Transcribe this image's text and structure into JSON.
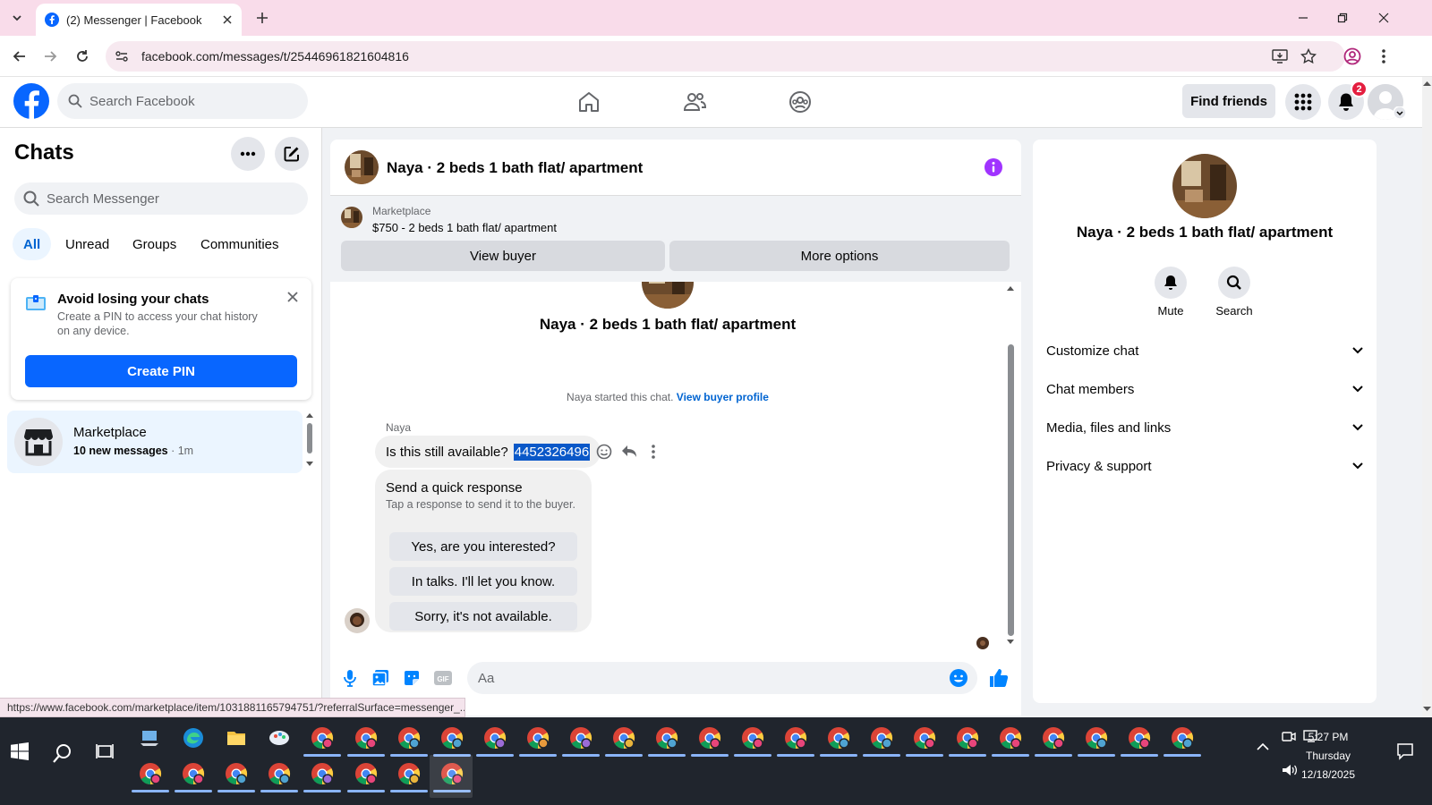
{
  "browser": {
    "tab_title": "(2) Messenger | Facebook",
    "url": "facebook.com/messages/t/25446961821604816",
    "status_url": "https://www.facebook.com/marketplace/item/1031881165794751/?referralSurface=messenger_..."
  },
  "fb": {
    "search_placeholder": "Search Facebook",
    "find_friends": "Find friends",
    "notif_count": "2"
  },
  "chats": {
    "title": "Chats",
    "search_placeholder": "Search Messenger",
    "filters": [
      "All",
      "Unread",
      "Groups",
      "Communities"
    ],
    "pin_card": {
      "title": "Avoid losing your chats",
      "desc": "Create a PIN to access your chat history on any device.",
      "button": "Create PIN"
    },
    "items": [
      {
        "name": "Marketplace",
        "preview": "10 new messages",
        "time": " · 1m"
      }
    ]
  },
  "conversation": {
    "title": "Naya · 2 beds 1 bath flat/ apartment",
    "marketplace_label": "Marketplace",
    "listing": "$750 - 2 beds 1 bath flat/ apartment",
    "view_buyer": "View buyer",
    "more_options": "More options",
    "started_text": "Naya started this chat.",
    "view_buyer_profile": "View buyer profile",
    "sender": "Naya",
    "message": "Is this still available?",
    "message_phone": "4452326496",
    "quick_title": "Send a quick response",
    "quick_sub": "Tap a response to send it to the buyer.",
    "quick_responses": [
      "Yes, are you interested?",
      "In talks. I'll let you know.",
      "Sorry, it's not available."
    ],
    "input_placeholder": "Aa"
  },
  "details": {
    "name": "Naya · 2 beds 1 bath flat/ apartment",
    "mute": "Mute",
    "search": "Search",
    "sections": [
      "Customize chat",
      "Chat members",
      "Media, files and links",
      "Privacy & support"
    ]
  },
  "taskbar": {
    "time": "5:27 PM",
    "day": "Thursday",
    "date": "12/18/2025"
  },
  "colors": {
    "fb_blue": "#0866ff",
    "messenger_blue": "#0084ff",
    "info_purple": "#a033ff",
    "tab_strip": "#f9dcea"
  }
}
